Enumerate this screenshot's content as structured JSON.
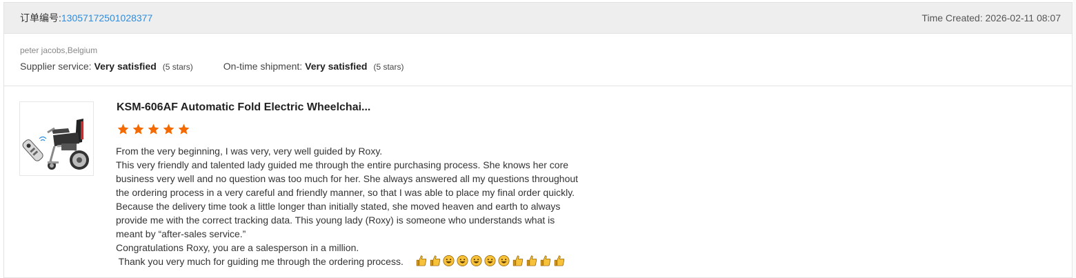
{
  "order": {
    "label": "订单编号:",
    "number": "13057172501028377",
    "time_created": "Time Created: 2026-02-11 08:07"
  },
  "buyer": {
    "name": "peter jacobs,Belgium",
    "supplier_service": {
      "label": "Supplier service:",
      "value": "Very satisfied",
      "stars": "(5 stars)"
    },
    "ontime_shipment": {
      "label": "On-time shipment:",
      "value": "Very satisfied",
      "stars": "(5 stars)"
    }
  },
  "review": {
    "product_title": "KSM-606AF Automatic Fold Electric Wheelchai...",
    "rating": 5,
    "star_color": "#f56a00",
    "lines": [
      "From the very beginning, I was very, very well guided by Roxy.",
      "This very friendly and talented lady guided me through the entire purchasing process. She knows her core",
      "business very well and no question was too much for her. She always answered all my questions throughout",
      "the ordering process in a very careful and friendly manner, so that I was able to place my final order quickly.",
      "Because the delivery time took a little longer than initially stated, she moved heaven and earth to always",
      "provide me with the correct tracking data. This young lady (Roxy) is someone who understands what is",
      "meant by “after-sales service.”",
      "Congratulations Roxy, you are a salesperson in a million.",
      " Thank you very much for guiding me through the ordering process."
    ],
    "emojis": [
      "thumbs-up",
      "thumbs-up",
      "grinning-face",
      "grinning-face",
      "grinning-face",
      "grinning-face",
      "grinning-face",
      "thumbs-up",
      "thumbs-up",
      "thumbs-up",
      "thumbs-up"
    ]
  }
}
